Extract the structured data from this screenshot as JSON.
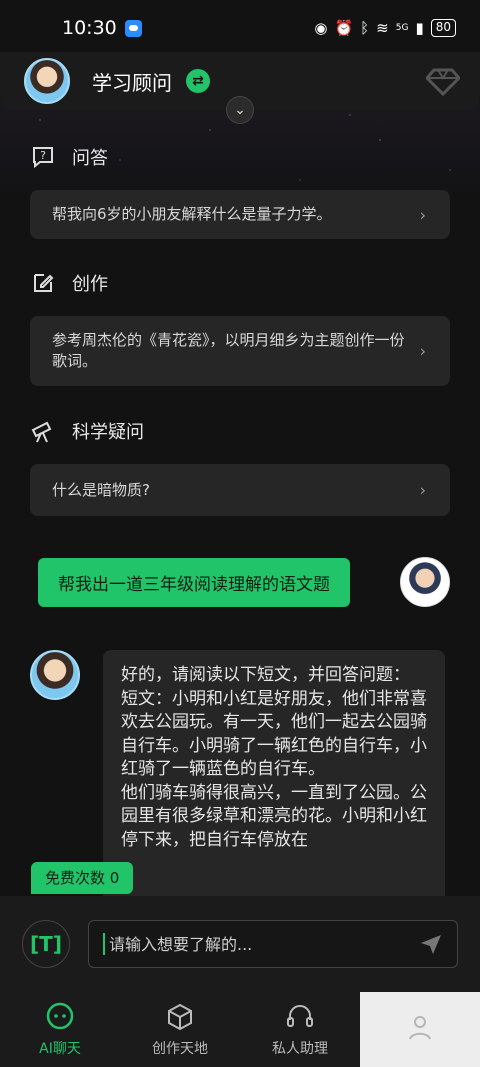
{
  "status": {
    "time": "10:30",
    "battery": "80",
    "net": "5G"
  },
  "header": {
    "title": "学习顾问"
  },
  "sections": [
    {
      "title": "问答",
      "text": "帮我向6岁的小朋友解释什么是量子力学。"
    },
    {
      "title": "创作",
      "text": "参考周杰伦的《青花瓷》，以明月细乡为主题创作一份歌词。"
    },
    {
      "title": "科学疑问",
      "text": "什么是暗物质?"
    }
  ],
  "chat": {
    "user_message": "帮我出一道三年级阅读理解的语文题",
    "bot_reply": "好的，请阅读以下短文，并回答问题：\n短文：小明和小红是好朋友，他们非常喜欢去公园玩。有一天，他们一起去公园骑自行车。小明骑了一辆红色的自行车，小红骑了一辆蓝色的自行车。\n他们骑车骑得很高兴，一直到了公园。公园里有很多绿草和漂亮的花。小明和小红停下来，把自行车停放在"
  },
  "free_count": "免费次数 0",
  "input": {
    "placeholder": "请输入想要了解的..."
  },
  "tabs": [
    {
      "label": "AI聊天",
      "icon": "chat-bubble-icon"
    },
    {
      "label": "创作天地",
      "icon": "cube-icon"
    },
    {
      "label": "私人助理",
      "icon": "headset-icon"
    },
    {
      "label": "",
      "icon": "profile-icon"
    }
  ],
  "colors": {
    "accent": "#22c46a",
    "background": "#121212",
    "card": "#262626"
  }
}
